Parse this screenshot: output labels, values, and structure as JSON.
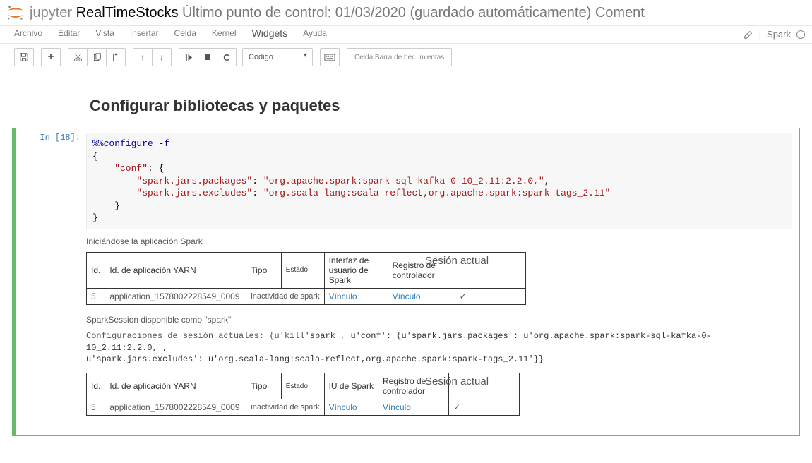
{
  "header": {
    "app": "jupyter",
    "notebook": "RealTimeStocks",
    "checkpoint": "Último punto de control: 01/03/2020 (guardado automáticamente)",
    "trailing": "Coment",
    "kernel_name": "Spark"
  },
  "menu": {
    "items": [
      "Archivo",
      "Editar",
      "Vista",
      "Insertar",
      "Celda",
      "Kernel",
      "Widgets",
      "Ayuda"
    ]
  },
  "toolbar": {
    "cell_type": "Código",
    "command_btn": "Celda Barra de her...mientas"
  },
  "heading": "Configurar bibliotecas y paquetes",
  "cell": {
    "prompt": "In [18]:",
    "code": {
      "l1": "%%configure -f",
      "l2": "{",
      "l3a": "    \"conf\"",
      "l3b": ": {",
      "l4a": "        \"spark.jars.packages\"",
      "l4b": ": ",
      "l4c": "\"org.apache.spark:spark-sql-kafka-0-10_2.11:2.2.0,\"",
      "l4d": ",",
      "l5a": "        \"spark.jars.excludes\"",
      "l5b": ": ",
      "l5c": "\"org.scala-lang:scala-reflect,org.apache.spark:spark-tags_2.11\"",
      "l6": "    }",
      "l7": "}"
    },
    "out1": "Iniciándose la aplicación Spark",
    "table1": {
      "h": [
        "Id.",
        "Id. de aplicación YARN",
        "Tipo",
        "Estado",
        "Interfaz de usuario de Spark",
        "Registro de controlador",
        "Sesión actual"
      ],
      "r": [
        "5",
        "application_1578002228549_0009",
        "inactividad de spark",
        "Vínculo",
        "Vínculo",
        "✓"
      ]
    },
    "out2": "SparkSession disponible como \"spark\"",
    "out3a": "Configuraciones de sesión actuales: {u'kill",
    "out3b": "'spark', u'conf': {u'spark.jars.packages': u'org.apache.spark:spark-sql-kafka-0-10_2.11:2.2.0,',",
    "out3c": "u'spark.jars.excludes': u'org.scala-lang:scala-reflect,org.apache.spark:spark-tags_2.11'}}",
    "table2": {
      "h": [
        "Id.",
        "Id. de aplicación YARN",
        "Tipo",
        "Estado",
        "IU de Spark",
        "Registro de controlador",
        "Sesión actual"
      ],
      "r": [
        "5",
        "application_1578002228549_0009",
        "inactividad de spark",
        "Vínculo",
        "Vínculo",
        "✓"
      ]
    }
  }
}
